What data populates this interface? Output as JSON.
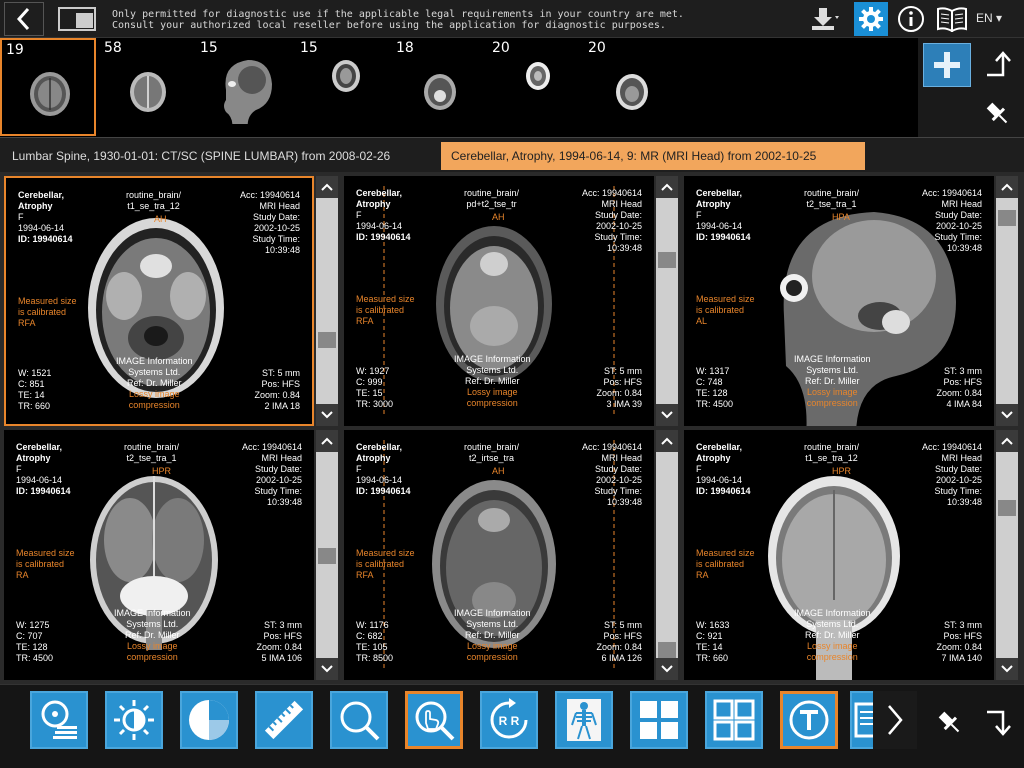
{
  "topbar": {
    "disclaimer_line1": "Only permitted for diagnostic use if the applicable legal requirements in your country are met.",
    "disclaimer_line2": "Consult your authorized local reseller before using the application for diagnostic purposes.",
    "language": "EN ▾",
    "icons": [
      "back-icon",
      "layout-icon",
      "download-icon",
      "gear-icon",
      "info-icon",
      "book-icon"
    ]
  },
  "thumbnails": [
    {
      "count": "19"
    },
    {
      "count": "58"
    },
    {
      "count": "15"
    },
    {
      "count": "15"
    },
    {
      "count": "18"
    },
    {
      "count": "20"
    },
    {
      "count": "20"
    }
  ],
  "study_tabs": [
    {
      "label": "Lumbar Spine, 1930-01-01: CT/SC (SPINE LUMBAR) from 2008-02-26"
    },
    {
      "label": "Cerebellar, Atrophy, 1994-06-14, 9: MR (MRI Head) from 2002-10-25"
    }
  ],
  "viewports": [
    {
      "patient": "Cerebellar,\nAtrophy",
      "sex": "F",
      "dob": "1994-06-14",
      "id": "ID: 19940614",
      "series": "routine_brain/\nt1_se_tra_12",
      "acc": "Acc: 19940614\nMRI Head\nStudy Date:\n2002-10-25\nStudy Time:\n10:39:48",
      "orient": "AH",
      "measure": "Measured size\nis calibrated\nRFA",
      "wl": "W: 1521\nC: 851\nTE: 14\nTR: 660",
      "info": "IMAGE Information\nSystems Ltd.\nRef: Dr. Miller",
      "lossy": "Lossy image\ncompression",
      "pos": "ST: 5 mm\nPos: HFS\nZoom: 0.84\n2 IMA 18"
    },
    {
      "patient": "Cerebellar,\nAtrophy",
      "sex": "F",
      "dob": "1994-06-14",
      "id": "ID: 19940614",
      "series": "routine_brain/\npd+t2_tse_tr",
      "acc": "Acc: 19940614\nMRI Head\nStudy Date:\n2002-10-25\nStudy Time:\n10:39:48",
      "orient": "AH",
      "measure": "Measured size\nis calibrated\nRFA",
      "wl": "W: 1927\nC: 999\nTE: 15\nTR: 3000",
      "info": "IMAGE Information\nSystems Ltd.\nRef: Dr. Miller",
      "lossy": "Lossy image\ncompression",
      "pos": "ST: 5 mm\nPos: HFS\nZoom: 0.84\n3 IMA 39"
    },
    {
      "patient": "Cerebellar,\nAtrophy",
      "sex": "F",
      "dob": "1994-06-14",
      "id": "ID: 19940614",
      "series": "routine_brain/\nt2_tse_tra_1",
      "acc": "Acc: 19940614\nMRI Head\nStudy Date:\n2002-10-25\nStudy Time:\n10:39:48",
      "orient": "HPA",
      "measure": "Measured size\nis calibrated\nAL",
      "wl": "W: 1317\nC: 748\nTE: 128\nTR: 4500",
      "info": "IMAGE Information\nSystems Ltd.\nRef: Dr. Miller",
      "lossy": "Lossy image\ncompression",
      "pos": "ST: 3 mm\nPos: HFS\nZoom: 0.84\n4 IMA 84"
    },
    {
      "patient": "Cerebellar,\nAtrophy",
      "sex": "F",
      "dob": "1994-06-14",
      "id": "ID: 19940614",
      "series": "routine_brain/\nt2_tse_tra_1",
      "acc": "Acc: 19940614\nMRI Head\nStudy Date:\n2002-10-25\nStudy Time:\n10:39:48",
      "orient": "HPR",
      "measure": "Measured size\nis calibrated\nRA",
      "wl": "W: 1275\nC: 707\nTE: 128\nTR: 4500",
      "info": "IMAGE Information\nSystems Ltd.\nRef: Dr. Miller",
      "lossy": "Lossy image\ncompression",
      "pos": "ST: 3 mm\nPos: HFS\nZoom: 0.84\n5 IMA 106"
    },
    {
      "patient": "Cerebellar,\nAtrophy",
      "sex": "F",
      "dob": "1994-06-14",
      "id": "ID: 19940614",
      "series": "routine_brain/\nt2_irtse_tra",
      "acc": "Acc: 19940614\nMRI Head\nStudy Date:\n2002-10-25\nStudy Time:\n10:39:48",
      "orient": "AH",
      "measure": "Measured size\nis calibrated\nRFA",
      "wl": "W: 1176\nC: 682\nTE: 105\nTR: 8500",
      "info": "IMAGE Information\nSystems Ltd.\nRef: Dr. Miller",
      "lossy": "Lossy image\ncompression",
      "pos": "ST: 5 mm\nPos: HFS\nZoom: 0.84\n6 IMA 126"
    },
    {
      "patient": "Cerebellar,\nAtrophy",
      "sex": "F",
      "dob": "1994-06-14",
      "id": "ID: 19940614",
      "series": "routine_brain/\nt1_se_tra_12",
      "acc": "Acc: 19940614\nMRI Head\nStudy Date:\n2002-10-25\nStudy Time:\n10:39:48",
      "orient": "HPR",
      "measure": "Measured size\nis calibrated\nRA",
      "wl": "W: 1633\nC: 921\nTE: 14\nTR: 660",
      "info": "IMAGE Information\nSystems Ltd.\nRef: Dr. Miller",
      "lossy": "Lossy image\ncompression",
      "pos": "ST: 3 mm\nPos: HFS\nZoom: 0.84\n7 IMA 140"
    }
  ],
  "toolbar": {
    "tools": [
      {
        "name": "film-stack-icon",
        "active": false
      },
      {
        "name": "brightness-contrast-icon",
        "active": false
      },
      {
        "name": "pie-section-icon",
        "active": false
      },
      {
        "name": "ruler-icon",
        "active": false
      },
      {
        "name": "magnifier-icon",
        "active": false
      },
      {
        "name": "magnifier-hand-icon",
        "active": true
      },
      {
        "name": "rotate-flip-icon",
        "active": false
      },
      {
        "name": "skeleton-icon",
        "active": false
      },
      {
        "name": "grid-2x2-icon",
        "active": false
      },
      {
        "name": "grid-2x2-outline-icon",
        "active": false
      },
      {
        "name": "text-annotation-icon",
        "active": true
      },
      {
        "name": "report-icon",
        "active": false
      }
    ],
    "rotate_label": "R R"
  },
  "colors": {
    "accent": "#e8852b",
    "tool_blue": "#2a92d0",
    "gear_blue": "#1a8fd6"
  }
}
